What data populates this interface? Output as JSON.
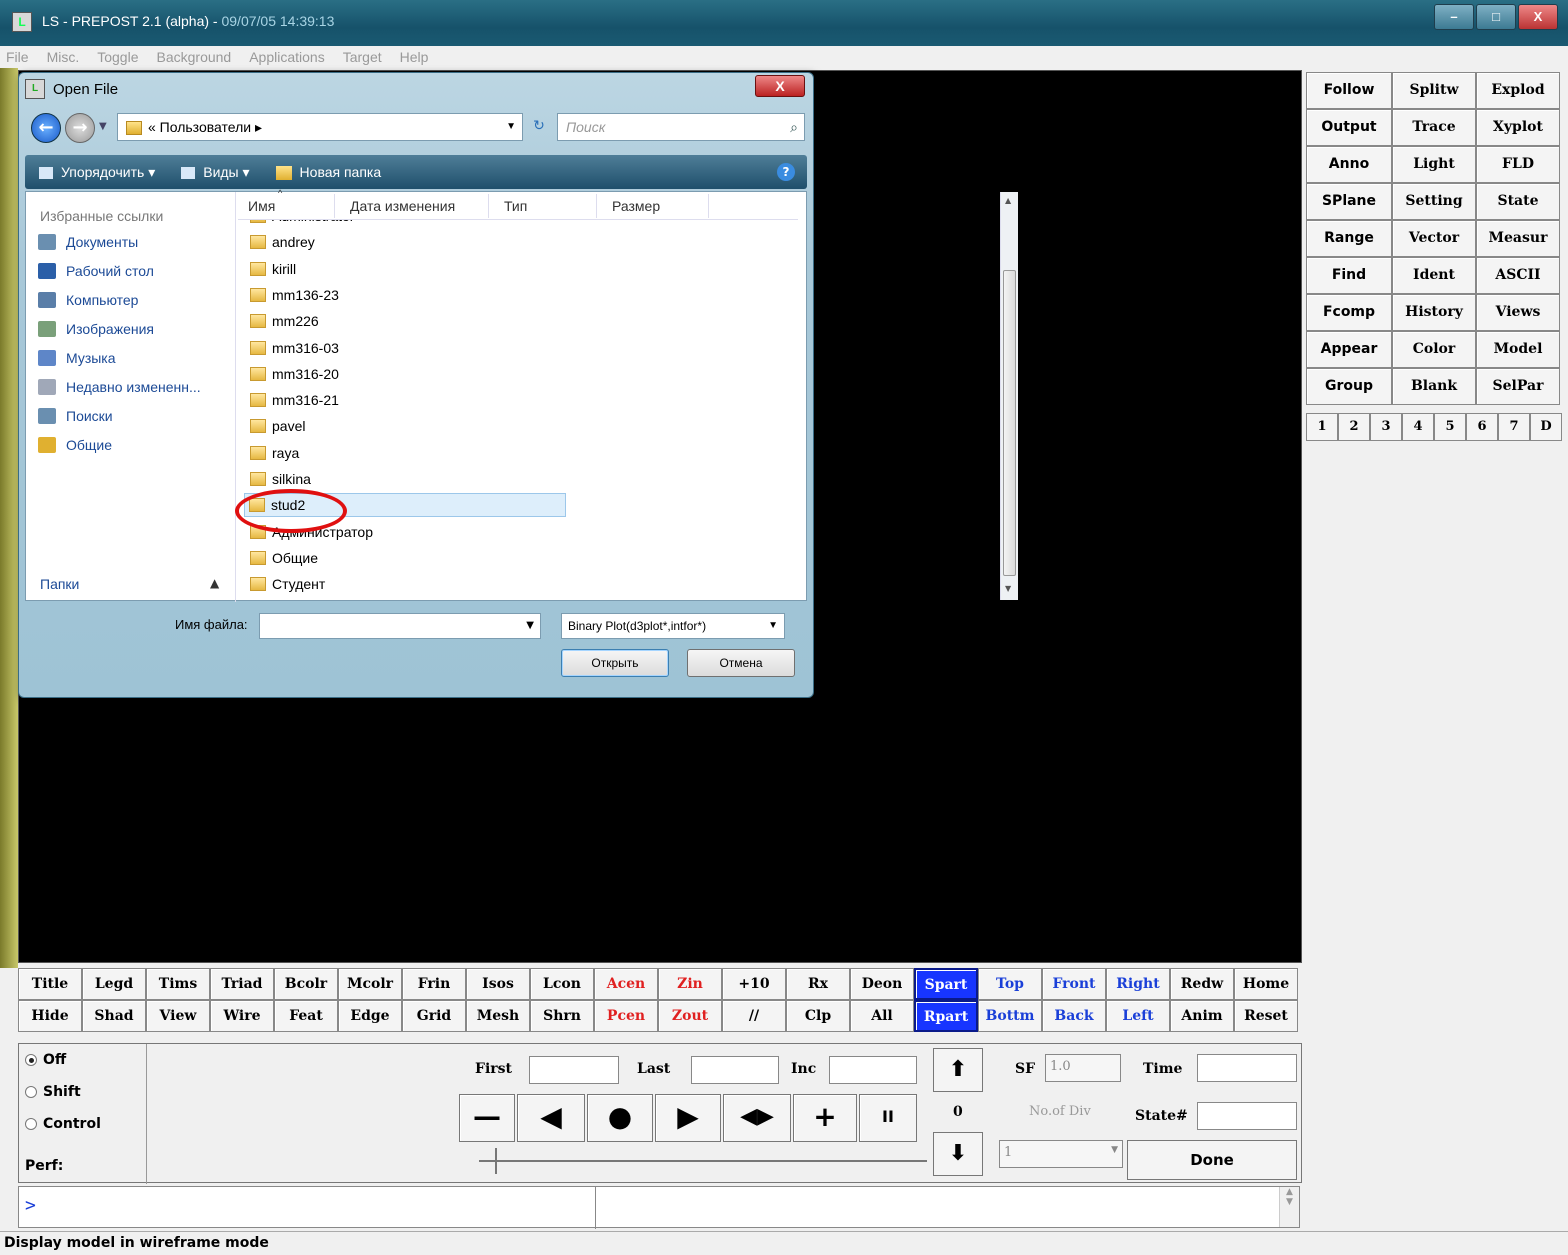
{
  "window": {
    "title": "LS - PREPOST 2.1 (alpha) - ",
    "date": "09/07/05 14:39:13",
    "controls": [
      "–",
      "□",
      "X"
    ]
  },
  "menu": [
    "File",
    "Misc.",
    "Toggle",
    "Background",
    "Applications",
    "Target",
    "Help"
  ],
  "right_panel": {
    "buttons": [
      "Follow",
      "Splitw",
      "Explod",
      "Output",
      "Trace",
      "Xyplot",
      "Anno",
      "Light",
      "FLD",
      "SPlane",
      "Setting",
      "State",
      "Range",
      "Vector",
      "Measur",
      "Find",
      "Ident",
      "ASCII",
      "Fcomp",
      "History",
      "Views",
      "Appear",
      "Color",
      "Model",
      "Group",
      "Blank",
      "SelPar"
    ],
    "pages": [
      "1",
      "2",
      "3",
      "4",
      "5",
      "6",
      "7",
      "D"
    ]
  },
  "toolbar_row1": [
    "Title",
    "Legd",
    "Tims",
    "Triad",
    "Bcolr",
    "Mcolr",
    "Frin",
    "Isos",
    "Lcon",
    "Acen",
    "Zin",
    "+10",
    "Rx",
    "Deon",
    "Spart",
    "Top",
    "Front",
    "Right",
    "Redw",
    "Home"
  ],
  "toolbar_row2": [
    "Hide",
    "Shad",
    "View",
    "Wire",
    "Feat",
    "Edge",
    "Grid",
    "Mesh",
    "Shrn",
    "Pcen",
    "Zout",
    "//",
    "Clp",
    "All",
    "Rpart",
    "Bottm",
    "Back",
    "Left",
    "Anim",
    "Reset"
  ],
  "anim": {
    "radios": [
      "Off",
      "Shift",
      "Control"
    ],
    "selected_radio": "Off",
    "perf": "Perf:",
    "first": "First",
    "last": "Last",
    "inc": "Inc",
    "sf": "SF",
    "sf_value": "1.0",
    "time": "Time",
    "no_of_div": "No.of Div",
    "div_value": "1",
    "state": "State#",
    "counter": "0",
    "done": "Done",
    "play_icons": [
      "—",
      "◀",
      "●",
      "▶",
      "◀▶",
      "+",
      "II"
    ],
    "up": "⬆",
    "down": "⬇"
  },
  "command": {
    "prompt": ">"
  },
  "status": "Display model in wireframe mode",
  "dialog": {
    "title": "Open File",
    "address": "« Пользователи ▸",
    "search_placeholder": "Поиск",
    "toolbar": [
      "Упорядочить ▾",
      "Виды ▾",
      "Новая папка"
    ],
    "favorites_header": "Избранные ссылки",
    "nav": [
      {
        "label": "Документы",
        "color": "#6a8fb0"
      },
      {
        "label": "Рабочий стол",
        "color": "#2b5fa8"
      },
      {
        "label": "Компьютер",
        "color": "#5a7ea8"
      },
      {
        "label": "Изображения",
        "color": "#7aa07a"
      },
      {
        "label": "Музыка",
        "color": "#5e86c8"
      },
      {
        "label": "Недавно измененн...",
        "color": "#a0a8b8"
      },
      {
        "label": "Поиски",
        "color": "#6a8fb0"
      },
      {
        "label": "Общие",
        "color": "#e0b030"
      }
    ],
    "folders_label": "Папки",
    "columns": [
      "Имя",
      "Дата изменения",
      "Тип",
      "Размер"
    ],
    "files": [
      "Administrator",
      "andrey",
      "kirill",
      "mm136-23",
      "mm226",
      "mm316-03",
      "mm316-20",
      "mm316-21",
      "pavel",
      "raya",
      "silkina",
      "stud2",
      "Администратор",
      "Общие",
      "Студент"
    ],
    "selected_file": "stud2",
    "filename_label": "Имя файла:",
    "filetype": "Binary Plot(d3plot*,intfor*)",
    "open": "Открыть",
    "cancel": "Отмена",
    "close": "X"
  }
}
